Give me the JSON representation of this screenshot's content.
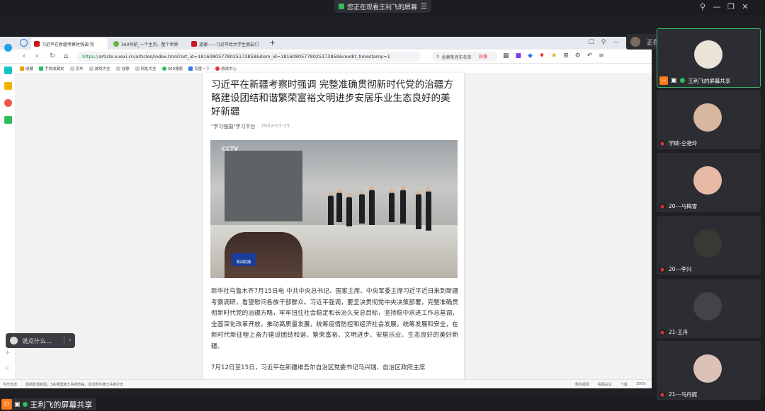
{
  "meeting": {
    "viewing_text": "您正在观看王利飞的屏幕",
    "share_label": "王利飞的屏幕共享",
    "speaking_label": "正在讲话: 王利飞"
  },
  "browser": {
    "tabs": [
      {
        "label": "习近平在新疆考察时强调 完",
        "active": true
      },
      {
        "label": "360导航_一个主页，整个世界",
        "active": false
      },
      {
        "label": "道德——习近平给大学生朋友们",
        "active": false
      }
    ],
    "new_tab_label": "+",
    "url_scheme": "https://",
    "url_rest": "article.xuexi.cn/articles/index.html?art_id=18160805778025173858&item_id=18160805778025173858&reedit_timestamp=1",
    "search_placeholder": "金庸笔涂实名单",
    "hot_label": "热搜",
    "bookmarks": [
      "收藏",
      "手机收藏夹",
      "京东",
      "游戏大全",
      "谷歌",
      "网址大全",
      "360搜索",
      "百度一下",
      "游戏中心"
    ],
    "status_left": [
      "今日优选",
      "最新职场新闻，3名英国籍士兵被枪毙，及成殉外籍士兵被打击"
    ],
    "status_right": [
      "我的视频",
      "看图关注",
      "下载",
      "100%"
    ]
  },
  "article": {
    "title": "习近平在新疆考察时强调 完整准确贯彻新时代党的治疆方略建设团结和谐繁荣富裕文明进步安居乐业生态良好的美好新疆",
    "source": "\"学习强国\"学习平台",
    "date": "2022-07-15",
    "photo_watermark": "CCTV",
    "photo_logo": "新闻联播",
    "paragraph1": "新华社乌鲁木齐7月15日电 中共中央总书记、国家主席、中央军委主席习近平近日来到新疆考察调研，看望慰问各族干部群众。习近平强调，要坚决贯彻党中央决策部署，完整准确贯彻新时代党的治疆方略，牢牢扭住社会稳定和长治久安总目标，坚持稳中求进工作总基调，全面深化改革开放，推动高质量发展，统筹疫情防控和经济社会发展，统筹发展和安全，在新时代新征程上奋力建设团结和谐、繁荣富裕、文明进步、安居乐业、生态良好的美好新疆。",
    "paragraph2": "7月12日至15日，习近平在新疆维吾尔自治区党委书记马兴瑞、自治区政府主席"
  },
  "chat_box": {
    "placeholder": "说点什么..."
  },
  "participants": [
    {
      "name": "王利飞的屏幕共享",
      "avatar_color": "#e9e3d8"
    },
    {
      "name": "学硕-仝艳玲",
      "avatar_color": "#d7b79e"
    },
    {
      "name": "20---马梅雪",
      "avatar_color": "#e8b9a4"
    },
    {
      "name": "20---李兴",
      "avatar_color": "#3a3833"
    },
    {
      "name": "21-王舟",
      "avatar_color": "#444448"
    },
    {
      "name": "21---马丹妮",
      "avatar_color": "#dcc2b6"
    }
  ]
}
